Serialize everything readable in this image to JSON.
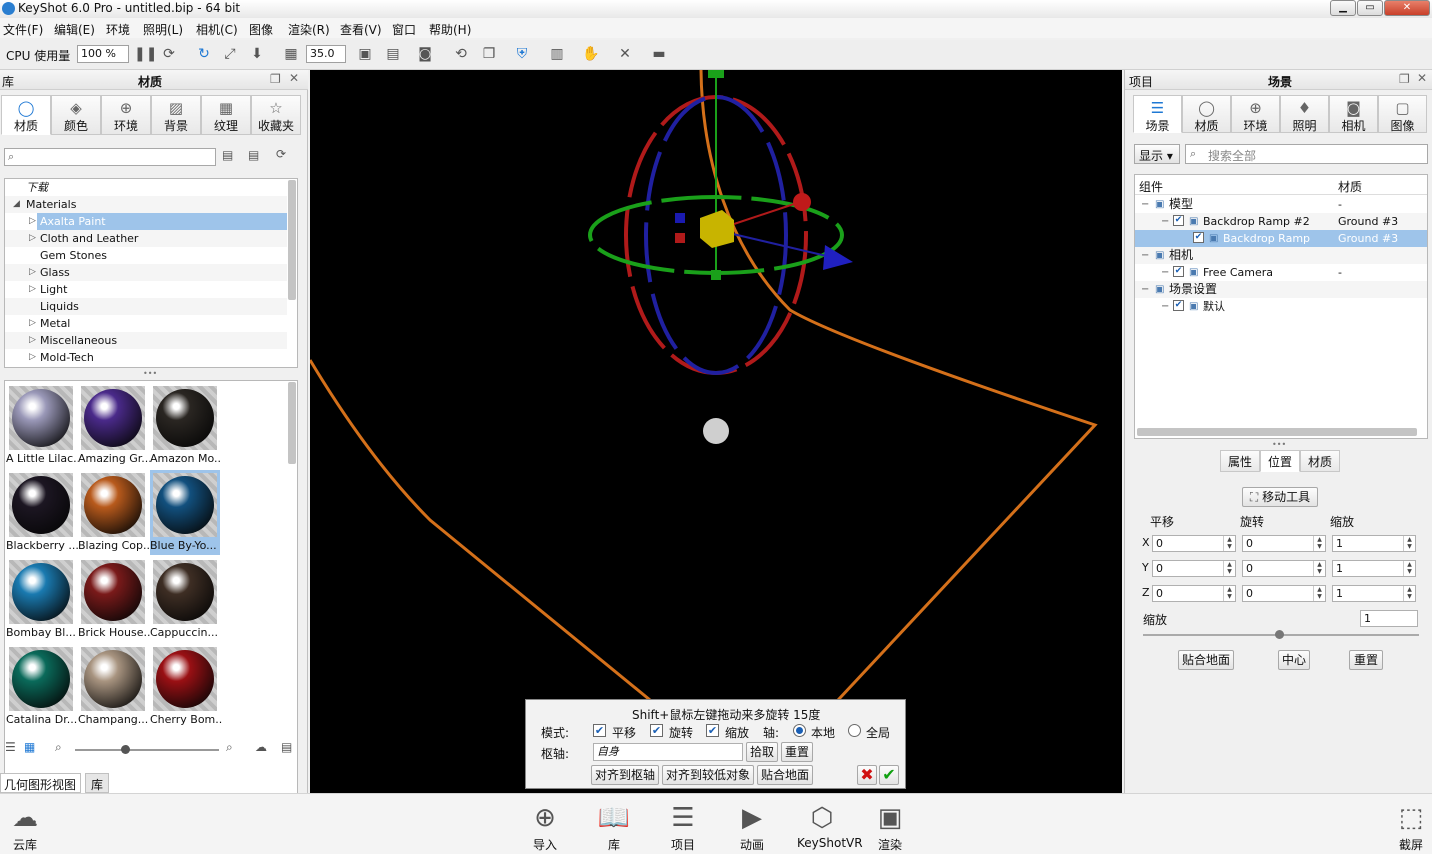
{
  "window": {
    "title": "KeyShot 6.0 Pro  - untitled.bip  - 64 bit",
    "minimize": "▁",
    "maximize": "▭",
    "close": "✕"
  },
  "menu": [
    "文件(F)",
    "编辑(E)",
    "环境",
    "照明(L)",
    "相机(C)",
    "图像",
    "渲染(R)",
    "查看(V)",
    "窗口",
    "帮助(H)"
  ],
  "toolbar": {
    "cpu_label": "CPU 使用量",
    "cpu_value": "100 %",
    "fov_value": "35.0"
  },
  "library": {
    "panel_label": "库",
    "title": "材质",
    "tabs": [
      {
        "label": "材质",
        "icon": "material-icon",
        "glyph": "◯"
      },
      {
        "label": "颜色",
        "icon": "color-icon",
        "glyph": "◈"
      },
      {
        "label": "环境",
        "icon": "environment-icon",
        "glyph": "⊕"
      },
      {
        "label": "背景",
        "icon": "backplate-icon",
        "glyph": "▨"
      },
      {
        "label": "纹理",
        "icon": "texture-icon",
        "glyph": "▦"
      },
      {
        "label": "收藏夹",
        "icon": "favorites-icon",
        "glyph": "☆"
      }
    ],
    "search_placeholder": "",
    "tree": [
      {
        "label": "下载",
        "indent": 0,
        "arrow": "",
        "italic": true
      },
      {
        "label": "Materials",
        "indent": 0,
        "arrow": "◢"
      },
      {
        "label": "Axalta Paint",
        "indent": 1,
        "arrow": "▷",
        "selected": true
      },
      {
        "label": "Cloth and Leather",
        "indent": 1,
        "arrow": "▷"
      },
      {
        "label": "Gem Stones",
        "indent": 1,
        "arrow": ""
      },
      {
        "label": "Glass",
        "indent": 1,
        "arrow": "▷"
      },
      {
        "label": "Light",
        "indent": 1,
        "arrow": "▷"
      },
      {
        "label": "Liquids",
        "indent": 1,
        "arrow": ""
      },
      {
        "label": "Metal",
        "indent": 1,
        "arrow": "▷"
      },
      {
        "label": "Miscellaneous",
        "indent": 1,
        "arrow": "▷"
      },
      {
        "label": "Mold-Tech",
        "indent": 1,
        "arrow": "▷"
      }
    ],
    "materials": [
      {
        "label": "A Little Lilac...",
        "color": "#9a98b8"
      },
      {
        "label": "Amazing Gr...",
        "color": "#4a2a8a"
      },
      {
        "label": "Amazon Mo...",
        "color": "#2a2622"
      },
      {
        "label": "Blackberry ...",
        "color": "#1c1622"
      },
      {
        "label": "Blazing Cop...",
        "color": "#b85a1c"
      },
      {
        "label": "Blue By-Yo...",
        "color": "#12507e",
        "selected": true
      },
      {
        "label": "Bombay Bl...",
        "color": "#1a7ab0"
      },
      {
        "label": "Brick House...",
        "color": "#7a1a1a"
      },
      {
        "label": "Cappuccin...",
        "color": "#3e2e24"
      },
      {
        "label": "Catalina Dr...",
        "color": "#0a6a5a"
      },
      {
        "label": "Champang...",
        "color": "#a89480"
      },
      {
        "label": "Cherry Bom...",
        "color": "#9a1014"
      }
    ],
    "bottom_tabs": [
      "几何图形视图",
      "库"
    ]
  },
  "viewport": {
    "hint": "Shift+鼠标左键拖动来多旋转 15度",
    "mode_label": "模式:",
    "translate": "平移",
    "rotate": "旋转",
    "scale": "缩放",
    "axis_label": "轴:",
    "local": "本地",
    "global": "全局",
    "pivot_label": "枢轴:",
    "pivot_value": "自身",
    "pick": "拾取",
    "reset": "重置",
    "align_pivot": "对齐到枢轴",
    "align_lower": "对齐到较低对象",
    "snap_ground": "贴合地面",
    "cancel": "✖",
    "ok": "✔"
  },
  "project": {
    "panel_label": "项目",
    "title": "场景",
    "tabs": [
      {
        "label": "场景",
        "icon": "scene-icon",
        "glyph": "☰"
      },
      {
        "label": "材质",
        "icon": "material-icon",
        "glyph": "◯"
      },
      {
        "label": "环境",
        "icon": "environment-icon",
        "glyph": "⊕"
      },
      {
        "label": "照明",
        "icon": "lighting-icon",
        "glyph": "♦"
      },
      {
        "label": "相机",
        "icon": "camera-icon",
        "glyph": "◙"
      },
      {
        "label": "图像",
        "icon": "image-icon",
        "glyph": "▢"
      }
    ],
    "show_label": "显示",
    "search_placeholder": "搜索全部",
    "col_component": "组件",
    "col_material": "材质",
    "tree": [
      {
        "label": "模型",
        "material": "-",
        "indent": 0
      },
      {
        "label": "Backdrop Ramp #2",
        "material": "Ground #3",
        "indent": 1
      },
      {
        "label": "Backdrop Ramp",
        "material": "Ground #3",
        "indent": 2,
        "selected": true
      },
      {
        "label": "相机",
        "material": "",
        "indent": 0
      },
      {
        "label": "Free Camera",
        "material": "-",
        "indent": 1
      },
      {
        "label": "场景设置",
        "material": "",
        "indent": 0
      },
      {
        "label": "默认",
        "material": "",
        "indent": 1
      }
    ],
    "sub_tabs": [
      "属性",
      "位置",
      "材质"
    ],
    "move_tool": "移动工具",
    "col_translate": "平移",
    "col_rotate": "旋转",
    "col_scale": "缩放",
    "rows": [
      {
        "axis": "X",
        "t": "0",
        "r": "0",
        "s": "1"
      },
      {
        "axis": "Y",
        "t": "0",
        "r": "0",
        "s": "1"
      },
      {
        "axis": "Z",
        "t": "0",
        "r": "0",
        "s": "1"
      }
    ],
    "uniform_scale_label": "缩放",
    "uniform_scale_value": "1",
    "snap_ground": "贴合地面",
    "center": "中心",
    "reset": "重置"
  },
  "bottom": [
    {
      "label": "云库",
      "icon": "cloud-library-icon",
      "glyph": "☁"
    },
    {
      "label": "导入",
      "icon": "import-icon",
      "glyph": "⊕"
    },
    {
      "label": "库",
      "icon": "library-book-icon",
      "glyph": "📖"
    },
    {
      "label": "项目",
      "icon": "project-list-icon",
      "glyph": "☰"
    },
    {
      "label": "动画",
      "icon": "animation-icon",
      "glyph": "▶"
    },
    {
      "label": "KeyShotVR",
      "icon": "keyshotvr-cube-icon",
      "glyph": "⬡"
    },
    {
      "label": "渲染",
      "icon": "render-icon",
      "glyph": "▣"
    },
    {
      "label": "截屏",
      "icon": "screenshot-icon",
      "glyph": "⬚"
    }
  ]
}
